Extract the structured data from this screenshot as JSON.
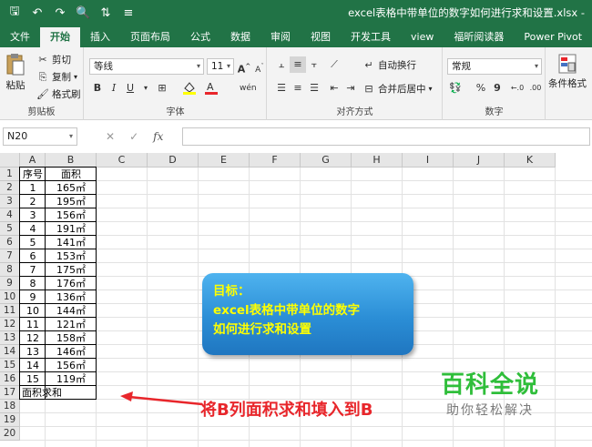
{
  "titlebar": {
    "save_icon": "save-icon",
    "undo_icon": "undo-icon",
    "redo_icon": "redo-icon",
    "print_preview_icon": "print-preview-icon",
    "sort_icon": "sort-icon",
    "customize_icon": "customize-icon",
    "filename": "excel表格中带单位的数字如何进行求和设置.xlsx -"
  },
  "tabs": [
    "文件",
    "开始",
    "插入",
    "页面布局",
    "公式",
    "数据",
    "审阅",
    "视图",
    "开发工具",
    "view",
    "福昕阅读器",
    "Power Pivot",
    "♀"
  ],
  "active_tab": "开始",
  "ribbon": {
    "clipboard": {
      "paste": "粘贴",
      "cut": "剪切",
      "copy": "复制",
      "format_painter": "格式刷",
      "label": "剪贴板"
    },
    "font": {
      "name": "等线",
      "size": "11",
      "grow": "A",
      "shrink": "A",
      "bold": "B",
      "italic": "I",
      "underline": "U",
      "label": "字体"
    },
    "alignment": {
      "wrap": "自动换行",
      "merge": "合并后居中",
      "label": "对齐方式"
    },
    "number": {
      "format": "常规",
      "percent": "%",
      "comma": "9",
      "label": "数字"
    },
    "styles": {
      "conditional": "条件格式"
    }
  },
  "formula_bar": {
    "name_box": "N20",
    "fx": "fx"
  },
  "columns": [
    "A",
    "B",
    "C",
    "D",
    "E",
    "F",
    "G",
    "H",
    "I",
    "J",
    "K"
  ],
  "rows": [
    "1",
    "2",
    "3",
    "4",
    "5",
    "6",
    "7",
    "8",
    "9",
    "10",
    "11",
    "12",
    "13",
    "14",
    "15",
    "16",
    "17",
    "18",
    "19",
    "20"
  ],
  "table": {
    "header": [
      "序号",
      "面积"
    ],
    "rows": [
      [
        "1",
        "165㎡"
      ],
      [
        "2",
        "195㎡"
      ],
      [
        "3",
        "156㎡"
      ],
      [
        "4",
        "191㎡"
      ],
      [
        "5",
        "141㎡"
      ],
      [
        "6",
        "153㎡"
      ],
      [
        "7",
        "175㎡"
      ],
      [
        "8",
        "176㎡"
      ],
      [
        "9",
        "136㎡"
      ],
      [
        "10",
        "144㎡"
      ],
      [
        "11",
        "121㎡"
      ],
      [
        "12",
        "158㎡"
      ],
      [
        "13",
        "146㎡"
      ],
      [
        "14",
        "156㎡"
      ],
      [
        "15",
        "119㎡"
      ]
    ],
    "sum_label": "面积求和"
  },
  "callout": {
    "line1": "目标：",
    "line2": "excel表格中带单位的数字",
    "line3": "如何进行求和设置"
  },
  "annotation": "将B列面积求和填入到B",
  "watermark": {
    "title": "百科全说",
    "subtitle": "助你轻松解决"
  },
  "colors": {
    "excel_green": "#217346",
    "callout_blue": "#2b8ed6",
    "callout_text": "#ffff00",
    "annotation_red": "#e8262b",
    "watermark_green": "#2fbe3a"
  }
}
